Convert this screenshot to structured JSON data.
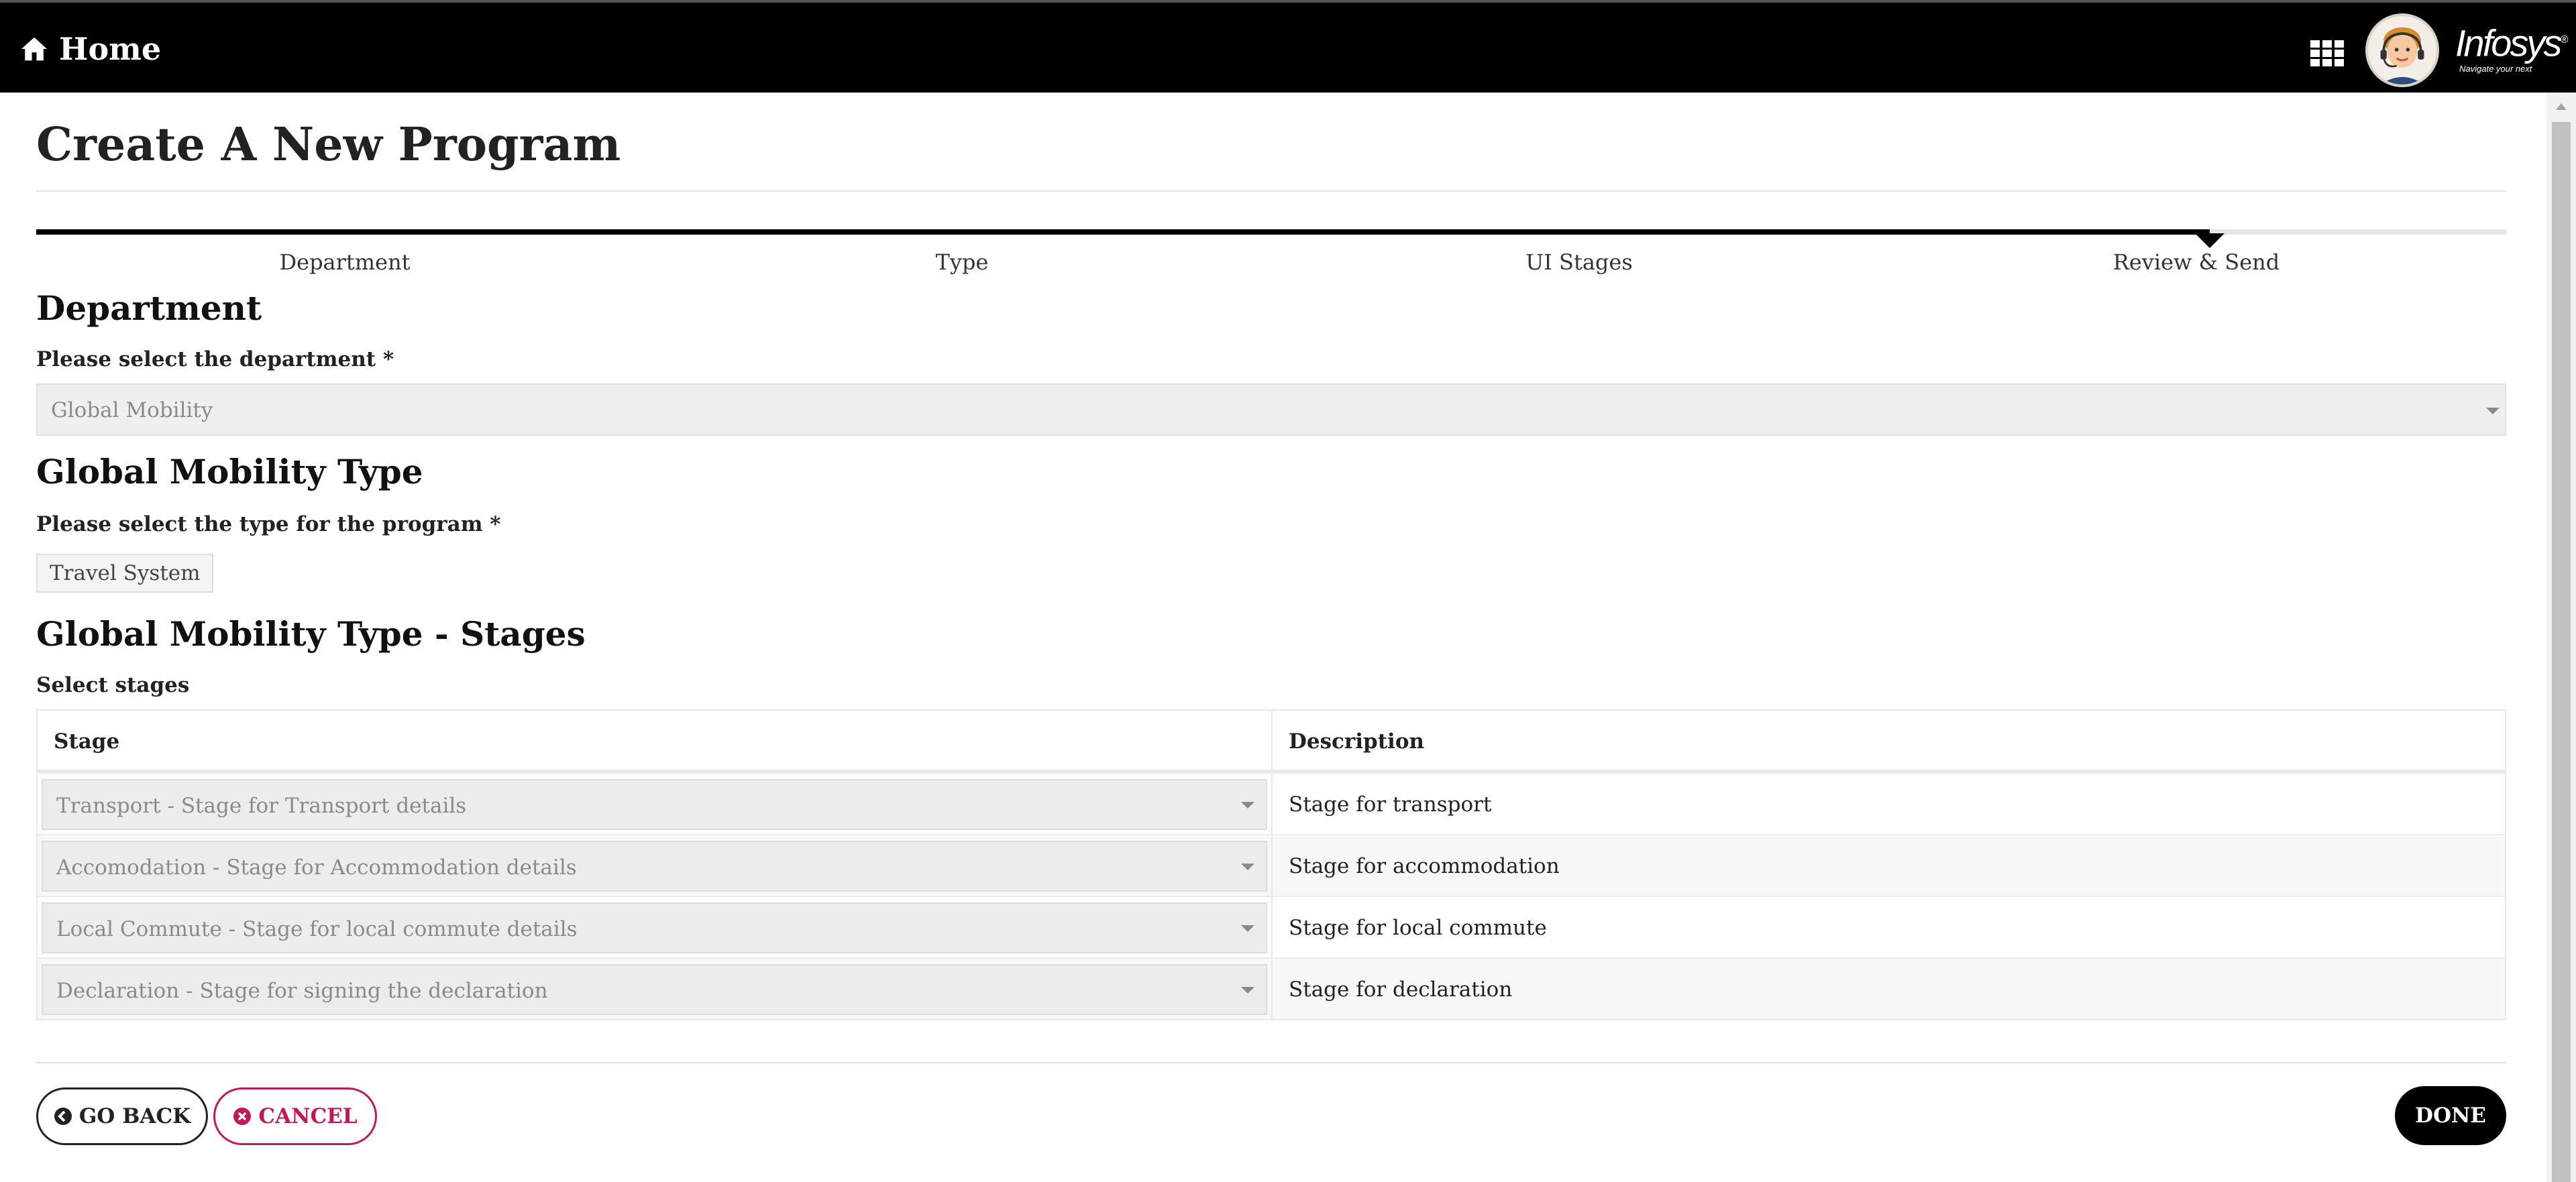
{
  "header": {
    "home_label": "Home",
    "brand_name": "Infosys",
    "brand_registered": "®",
    "brand_tagline": "Navigate your next",
    "icons": [
      "home-icon",
      "apps-grid-icon",
      "user-avatar",
      "infosys-logo"
    ]
  },
  "page": {
    "title": "Create A New Program"
  },
  "stepper": {
    "steps": [
      {
        "label": "Department"
      },
      {
        "label": "Type"
      },
      {
        "label": "UI Stages"
      },
      {
        "label": "Review & Send"
      }
    ],
    "active_step": "Review & Send"
  },
  "department_section": {
    "heading": "Department",
    "label": "Please select the department *",
    "selected": "Global Mobility"
  },
  "type_section": {
    "heading": "Global Mobility Type",
    "label": "Please select the type for the program *",
    "selected_chip": "Travel System"
  },
  "stages_section": {
    "heading": "Global Mobility Type - Stages",
    "label": "Select stages",
    "columns": [
      "Stage",
      "Description"
    ],
    "rows": [
      {
        "stage": "Transport - Stage for Transport details",
        "description": "Stage for transport"
      },
      {
        "stage": "Accomodation - Stage for Accommodation details",
        "description": "Stage for accommodation"
      },
      {
        "stage": "Local Commute - Stage for local commute details",
        "description": "Stage for local commute"
      },
      {
        "stage": "Declaration - Stage for signing the declaration",
        "description": "Stage for declaration"
      }
    ]
  },
  "actions": {
    "go_back": "GO BACK",
    "cancel": "CANCEL",
    "done": "DONE"
  },
  "colors": {
    "topbar": "#000000",
    "cancel_accent": "#c2185b",
    "done_bg": "#000000"
  }
}
